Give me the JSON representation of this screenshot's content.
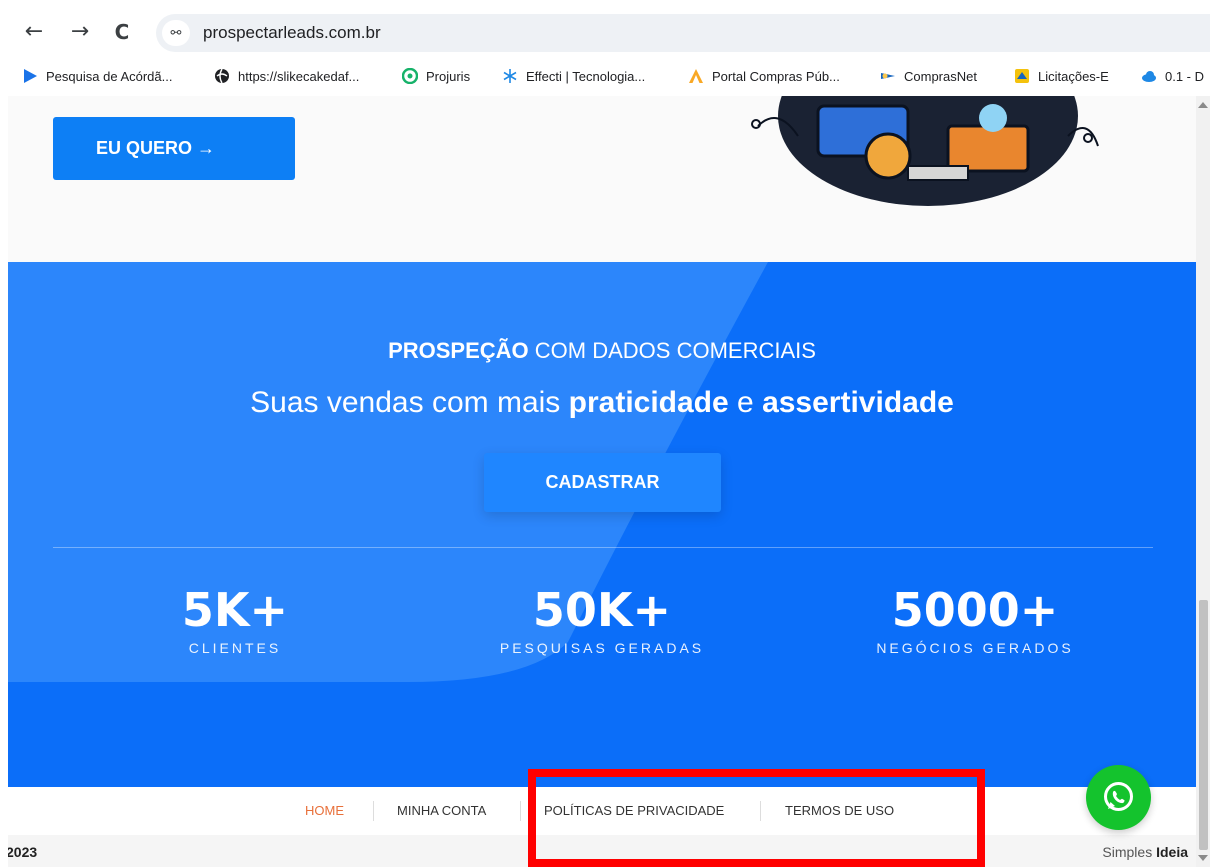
{
  "browser": {
    "url": "prospectarleads.com.br",
    "back_icon": "←",
    "forward_icon": "→",
    "reload_icon": "C",
    "site_info_icon": "⚯",
    "bookmarks": [
      {
        "label": "Pesquisa de Acórdã...",
        "icon": "triangle-play-icon",
        "color": "#1a73e8"
      },
      {
        "label": "https://slikecakedaf...",
        "icon": "globe-icon",
        "color": "#202124"
      },
      {
        "label": "Projuris",
        "icon": "projuris-icon",
        "color": "#17b26a"
      },
      {
        "label": "Effecti | Tecnologia...",
        "icon": "snowflake-icon",
        "color": "#1e88e5"
      },
      {
        "label": "Portal Compras Púb...",
        "icon": "portal-compras-icon",
        "color": "#f9a825"
      },
      {
        "label": "ComprasNet",
        "icon": "comprasnet-icon",
        "color": "#1565c0"
      },
      {
        "label": "Licitações-E",
        "icon": "licitacoes-icon",
        "color": "#f4c20d"
      },
      {
        "label": "0.1 - D",
        "icon": "cloud-icon",
        "color": "#1e88e5"
      }
    ]
  },
  "hero": {
    "cta_label": "EU QUERO →"
  },
  "stats_section": {
    "title_bold": "PROSPEÇÃO",
    "title_rest": " COM DADOS COMERCIAIS",
    "subtitle_a": "Suas vendas com mais ",
    "subtitle_b": "praticidade",
    "subtitle_c": " e ",
    "subtitle_d": "assertividade",
    "button_label": "CADASTRAR",
    "items": [
      {
        "value": "5K+",
        "label": "CLIENTES"
      },
      {
        "value": "50K+",
        "label": "PESQUISAS GERADAS"
      },
      {
        "value": "5000+",
        "label": "NEGÓCIOS GERADOS"
      }
    ]
  },
  "footer": {
    "menu": [
      {
        "label": "HOME",
        "color": "#e8703a"
      },
      {
        "label": "MINHA CONTA",
        "color": "#333333"
      },
      {
        "label": "POLÍTICAS DE PRIVACIDADE",
        "color": "#333333"
      },
      {
        "label": "TERMOS DE USO",
        "color": "#333333"
      }
    ],
    "year": "2023",
    "credit_a": "Simples ",
    "credit_b": "Ideia"
  },
  "colors": {
    "primary": "#0b6ef9",
    "highlight": "#ff0000",
    "whatsapp": "#14c32d"
  }
}
